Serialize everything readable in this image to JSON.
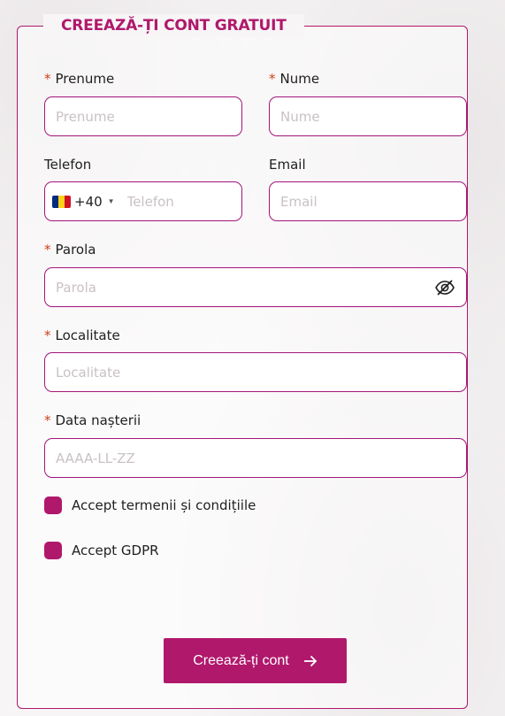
{
  "form": {
    "title": "CREEAZĂ-ȚI CONT GRATUIT",
    "accent_color": "#b0186c",
    "required_marker": "*",
    "fields": {
      "first_name": {
        "label": "Prenume",
        "placeholder": "Prenume",
        "required": true
      },
      "last_name": {
        "label": "Nume",
        "placeholder": "Nume",
        "required": true
      },
      "phone": {
        "label": "Telefon",
        "placeholder": "Telefon",
        "country_code": "+40",
        "country_flag": "romania-flag-icon",
        "required": false
      },
      "email": {
        "label": "Email",
        "placeholder": "Email",
        "required": false
      },
      "password": {
        "label": "Parola",
        "placeholder": "Parola",
        "required": true,
        "toggle_icon": "eye-slash-icon"
      },
      "city": {
        "label": "Localitate",
        "placeholder": "Localitate",
        "required": true
      },
      "birth_date": {
        "label": "Data nașterii",
        "placeholder": "AAAA-LL-ZZ",
        "required": true
      }
    },
    "checkboxes": {
      "terms": {
        "label": "Accept termenii și condițiile"
      },
      "gdpr": {
        "label": "Accept GDPR"
      }
    },
    "submit": {
      "label": "Creează-ți cont",
      "icon": "arrow-right-icon"
    }
  }
}
